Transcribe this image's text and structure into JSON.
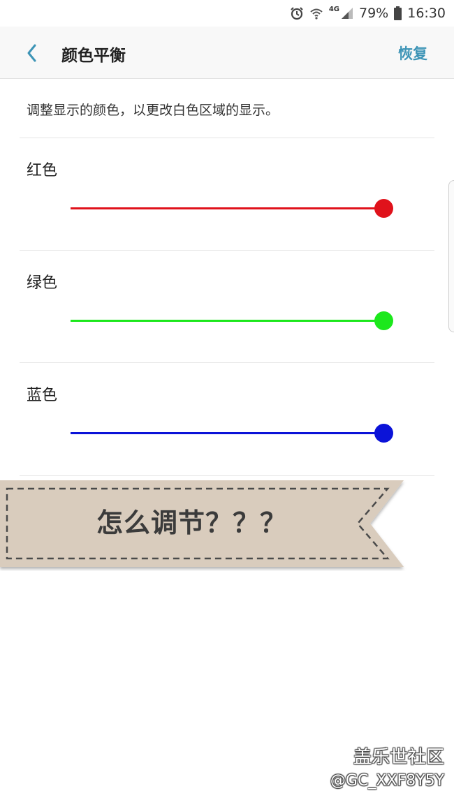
{
  "status_bar": {
    "network": "4G",
    "battery": "79%",
    "time": "16:30",
    "icons": [
      "alarm-icon",
      "wifi-icon",
      "signal-icon",
      "battery-icon"
    ]
  },
  "app_bar": {
    "back_icon": "chevron-left-icon",
    "title": "颜色平衡",
    "reset_label": "恢复",
    "accent_color": "#3d94b6"
  },
  "description": "调整显示的颜色，以更改白色区域的显示。",
  "sliders": [
    {
      "label": "红色",
      "color": "#e0121b",
      "value": 1.0
    },
    {
      "label": "绿色",
      "color": "#1ce81c",
      "value": 1.0
    },
    {
      "label": "蓝色",
      "color": "#0b13d8",
      "value": 1.0
    }
  ],
  "banner": {
    "text": "怎么调节？？？"
  },
  "watermark": {
    "title": "盖乐世社区",
    "handle": "@GC_XXF8Y5Y"
  }
}
